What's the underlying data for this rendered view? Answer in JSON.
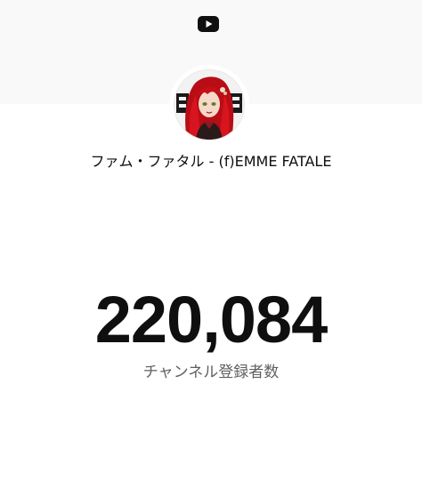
{
  "header": {
    "logo_icon": "youtube-play-icon",
    "band_color": "#f9f9f9"
  },
  "channel": {
    "avatar_icon": "channel-avatar-image",
    "name": "ファム・ファタル - (f)EMME FATALE"
  },
  "stats": {
    "subscriber_count": "220,084",
    "subscriber_label": "チャンネル登録者数"
  },
  "colors": {
    "text_primary": "#0f0f0f",
    "text_secondary": "#606060",
    "avatar_hair": "#c8101a"
  }
}
